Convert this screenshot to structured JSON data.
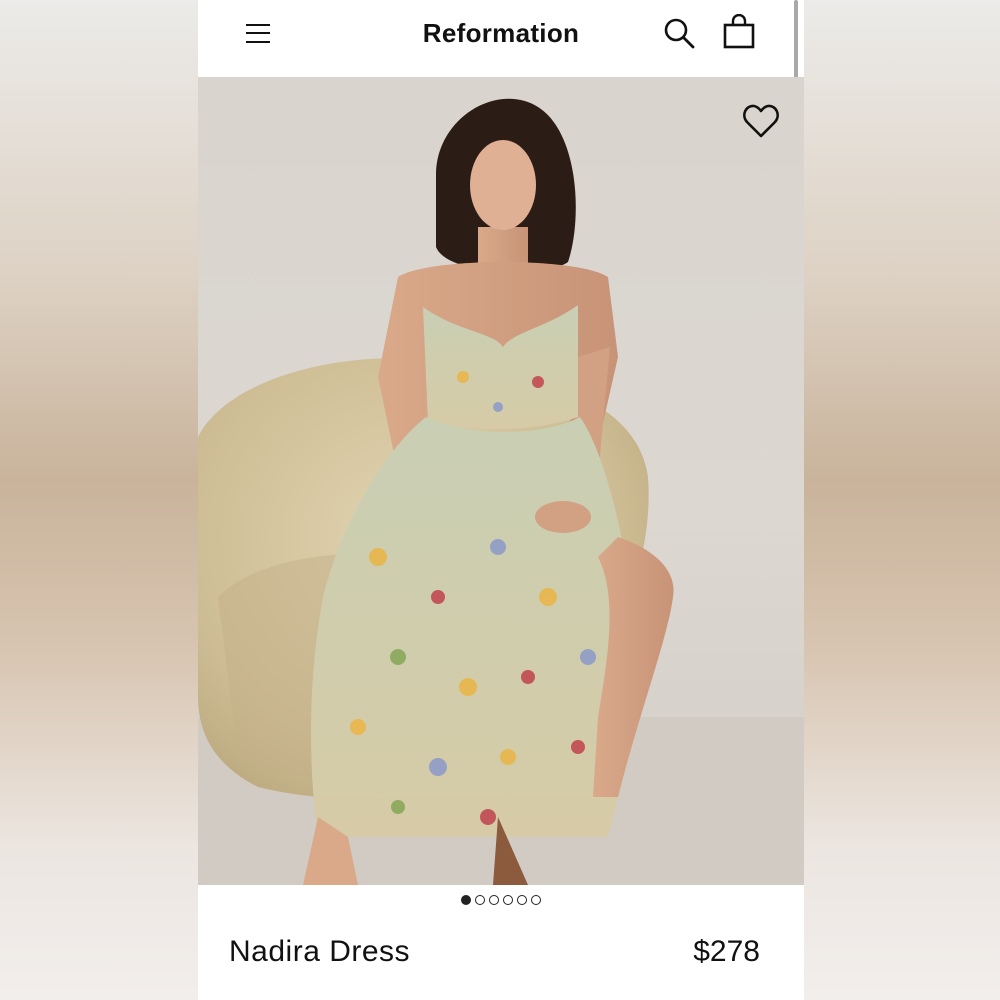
{
  "header": {
    "brand": "Reformation",
    "menu_icon": "hamburger-menu-icon",
    "search_icon": "search-icon",
    "bag_icon": "shopping-bag-icon"
  },
  "hero": {
    "image_alt": "Model seated on a beige armchair wearing a floral midi dress",
    "wishlist_icon": "heart-icon",
    "carousel": {
      "count": 6,
      "active": 0
    }
  },
  "product": {
    "name": "Nadira Dress",
    "price": "$278"
  },
  "colors": {
    "text": "#111111",
    "background": "#ffffff",
    "hero_bg": "#d9d4ce",
    "chair": "#d8c9a4"
  }
}
